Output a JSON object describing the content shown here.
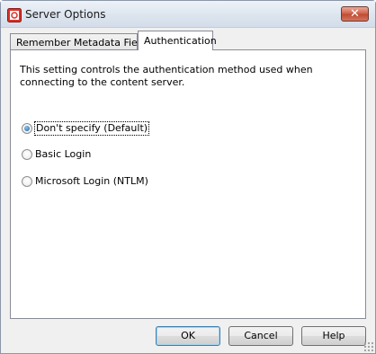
{
  "window": {
    "title": "Server Options",
    "close_label": "✕"
  },
  "tabs": [
    {
      "label": "Remember Metadata Fields",
      "selected": false
    },
    {
      "label": "Authentication",
      "selected": true
    }
  ],
  "panel": {
    "description_line1": "This setting controls the authentication method used when",
    "description_line2": "connecting to the content server.",
    "options": [
      {
        "label": "Don't specify (Default)",
        "checked": true
      },
      {
        "label": "Basic Login",
        "checked": false
      },
      {
        "label": "Microsoft Login (NTLM)",
        "checked": false
      }
    ]
  },
  "buttons": {
    "ok": "OK",
    "cancel": "Cancel",
    "help": "Help"
  },
  "colors": {
    "accent": "#3c7fb1",
    "close": "#c14a31"
  },
  "icons": {
    "app": "server-app-icon",
    "close": "close-icon"
  }
}
